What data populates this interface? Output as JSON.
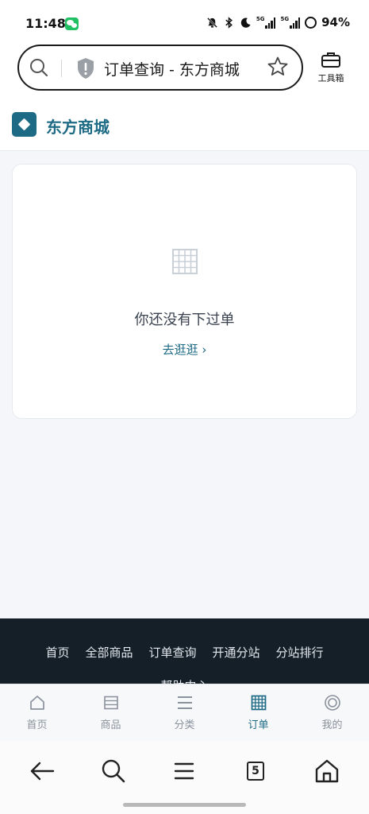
{
  "status_bar": {
    "time": "11:48",
    "battery": "94%",
    "network_labels": [
      "5G",
      "5G"
    ]
  },
  "browser": {
    "url_title": "订单查询 - 东方商城",
    "toolbox_label": "工具箱"
  },
  "site": {
    "brand_name": "东方商城",
    "brand_color": "#1d6a84"
  },
  "orders": {
    "empty_message": "你还没有下过单",
    "shop_link": "去逛逛 ›"
  },
  "footer": {
    "links": [
      "首页",
      "全部商品",
      "订单查询",
      "开通分站",
      "分站排行"
    ],
    "help": "帮助中心"
  },
  "tab_bar": {
    "tabs": [
      {
        "label": "首页",
        "icon": "home-icon"
      },
      {
        "label": "商品",
        "icon": "list-icon"
      },
      {
        "label": "分类",
        "icon": "menu-icon"
      },
      {
        "label": "订单",
        "icon": "grid-icon",
        "active": true
      },
      {
        "label": "我的",
        "icon": "profile-icon"
      }
    ]
  },
  "system_nav": {
    "tab_count": "5"
  }
}
